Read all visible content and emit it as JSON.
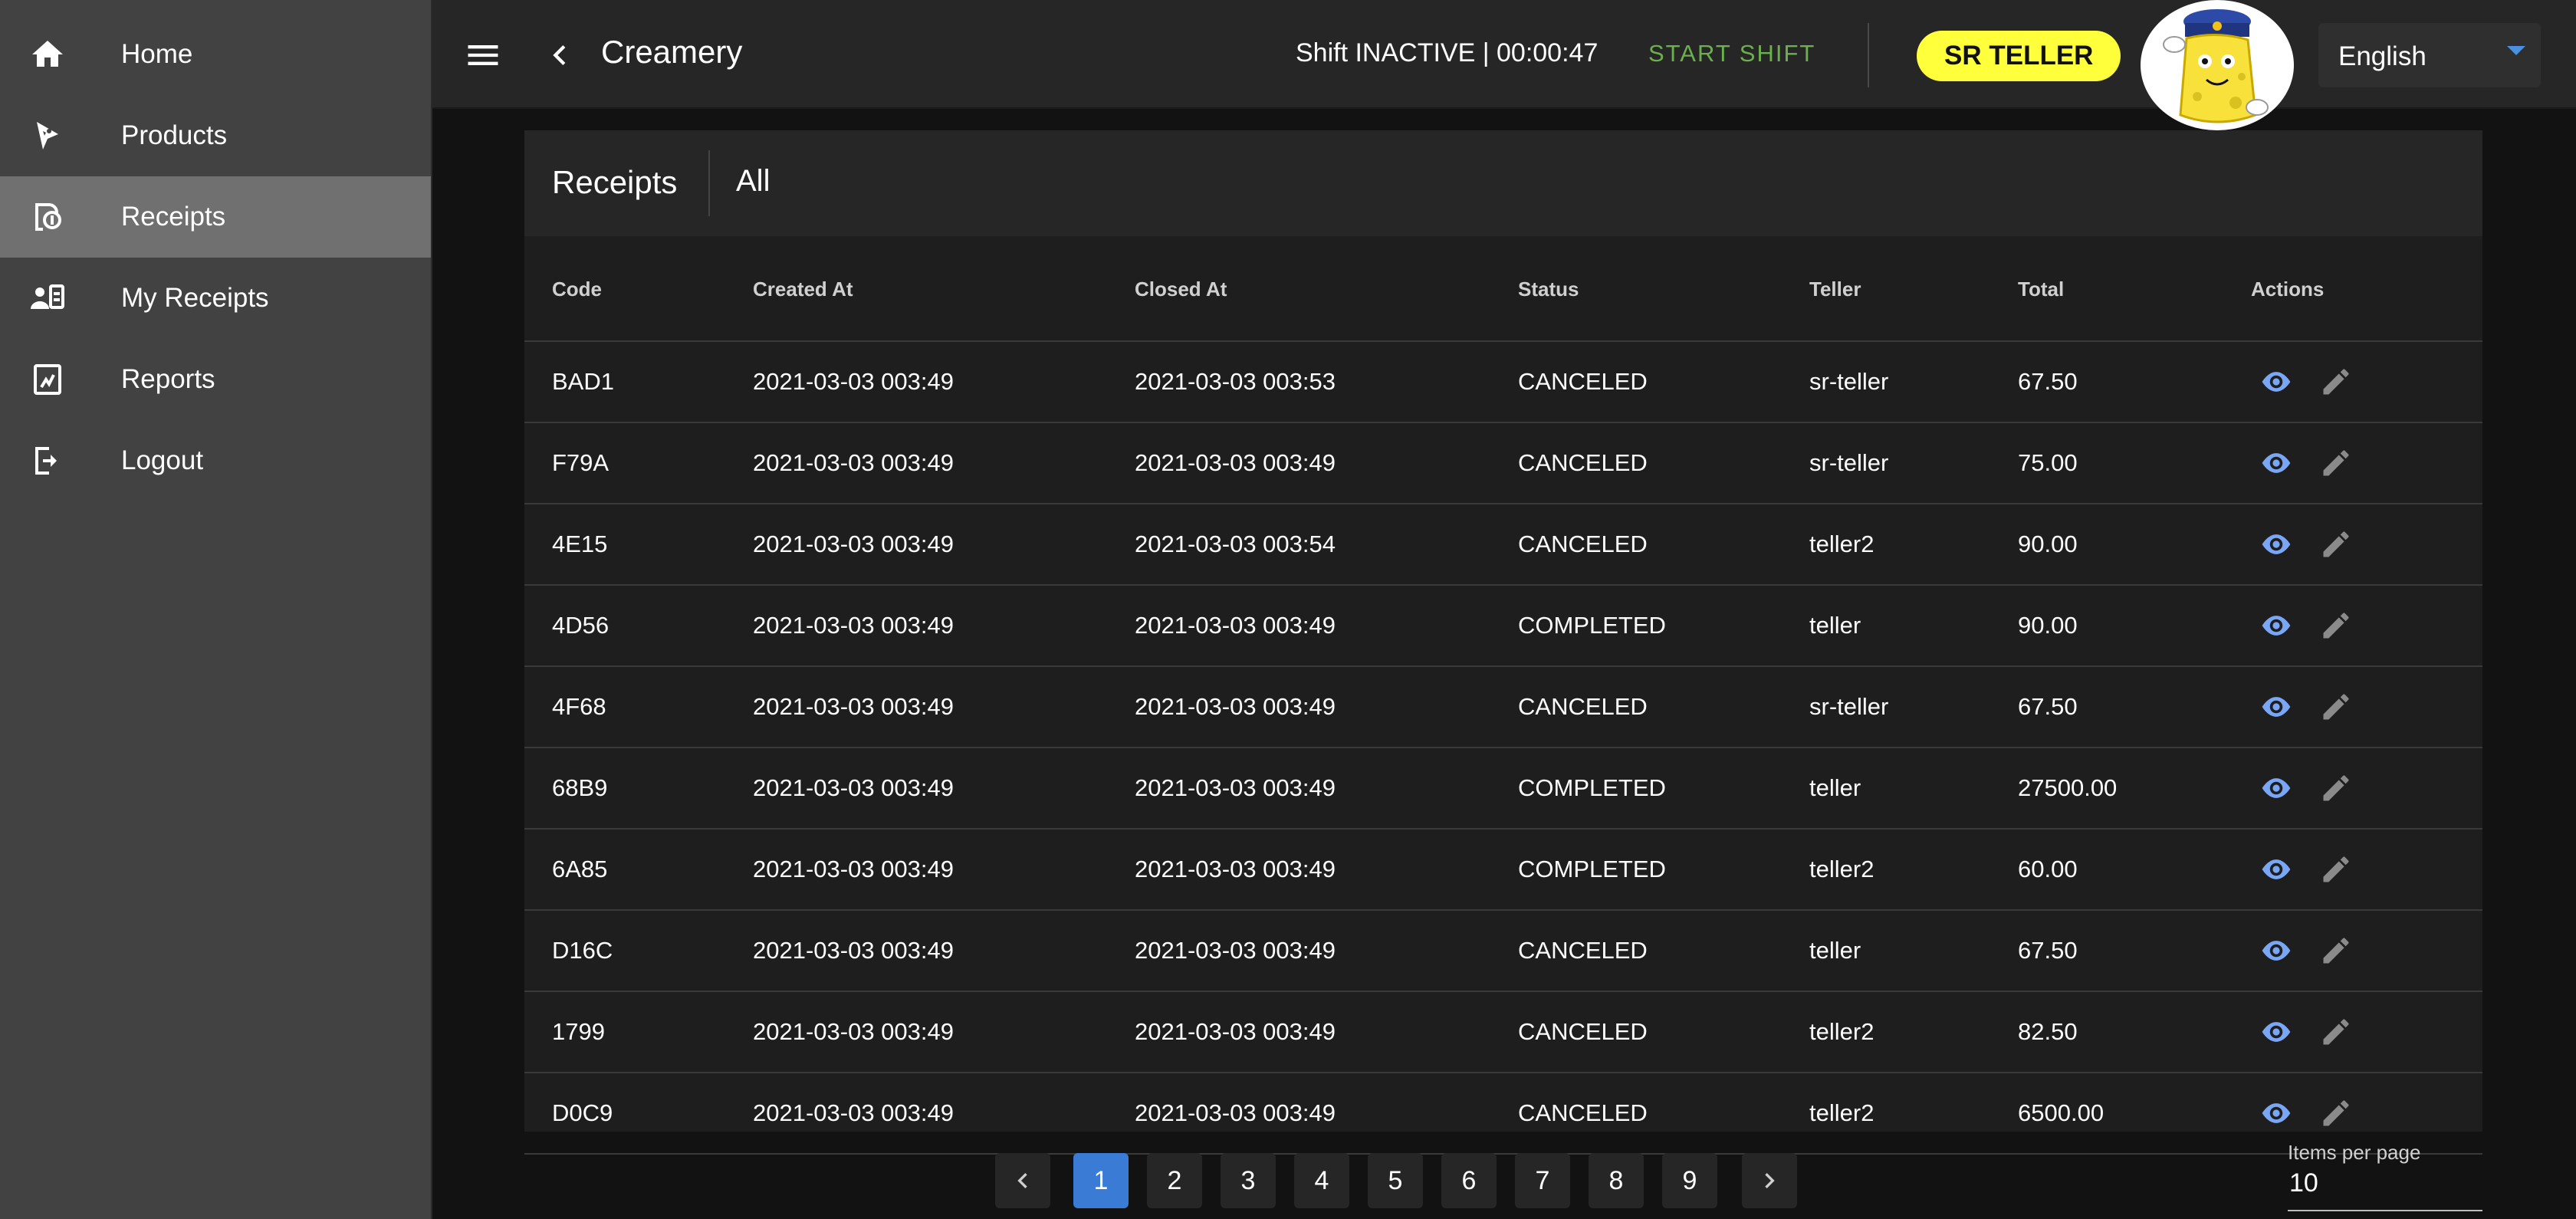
{
  "sidebar": {
    "items": [
      {
        "label": "Home",
        "icon": "home-icon"
      },
      {
        "label": "Products",
        "icon": "products-icon"
      },
      {
        "label": "Receipts",
        "icon": "receipts-icon",
        "active": true
      },
      {
        "label": "My Receipts",
        "icon": "my-receipts-icon"
      },
      {
        "label": "Reports",
        "icon": "reports-icon"
      },
      {
        "label": "Logout",
        "icon": "logout-icon"
      }
    ]
  },
  "header": {
    "title": "Creamery",
    "shift_status": "Shift INACTIVE | 00:00:47",
    "start_shift_label": "START SHIFT",
    "role_badge": "SR TELLER",
    "language": "English"
  },
  "colors": {
    "accent": "#3a7bd5",
    "badge": "#ffff3c",
    "start_shift": "#6ab04c",
    "action_icon_view": "#7aa7f5"
  },
  "card": {
    "title": "Receipts",
    "filter": "All"
  },
  "table": {
    "columns": [
      "Code",
      "Created At",
      "Closed At",
      "Status",
      "Teller",
      "Total",
      "Actions"
    ],
    "rows": [
      {
        "code": "BAD1",
        "created": "2021-03-03 003:49",
        "closed": "2021-03-03 003:53",
        "status": "CANCELED",
        "teller": "sr-teller",
        "total": "67.50"
      },
      {
        "code": "F79A",
        "created": "2021-03-03 003:49",
        "closed": "2021-03-03 003:49",
        "status": "CANCELED",
        "teller": "sr-teller",
        "total": "75.00"
      },
      {
        "code": "4E15",
        "created": "2021-03-03 003:49",
        "closed": "2021-03-03 003:54",
        "status": "CANCELED",
        "teller": "teller2",
        "total": "90.00"
      },
      {
        "code": "4D56",
        "created": "2021-03-03 003:49",
        "closed": "2021-03-03 003:49",
        "status": "COMPLETED",
        "teller": "teller",
        "total": "90.00"
      },
      {
        "code": "4F68",
        "created": "2021-03-03 003:49",
        "closed": "2021-03-03 003:49",
        "status": "CANCELED",
        "teller": "sr-teller",
        "total": "67.50"
      },
      {
        "code": "68B9",
        "created": "2021-03-03 003:49",
        "closed": "2021-03-03 003:49",
        "status": "COMPLETED",
        "teller": "teller",
        "total": "27500.00"
      },
      {
        "code": "6A85",
        "created": "2021-03-03 003:49",
        "closed": "2021-03-03 003:49",
        "status": "COMPLETED",
        "teller": "teller2",
        "total": "60.00"
      },
      {
        "code": "D16C",
        "created": "2021-03-03 003:49",
        "closed": "2021-03-03 003:49",
        "status": "CANCELED",
        "teller": "teller",
        "total": "67.50"
      },
      {
        "code": "1799",
        "created": "2021-03-03 003:49",
        "closed": "2021-03-03 003:49",
        "status": "CANCELED",
        "teller": "teller2",
        "total": "82.50"
      },
      {
        "code": "D0C9",
        "created": "2021-03-03 003:49",
        "closed": "2021-03-03 003:49",
        "status": "CANCELED",
        "teller": "teller2",
        "total": "6500.00"
      }
    ]
  },
  "pagination": {
    "pages": [
      "1",
      "2",
      "3",
      "4",
      "5",
      "6",
      "7",
      "8",
      "9"
    ],
    "current": "1",
    "items_per_page_label": "Items per page",
    "items_per_page": "10"
  }
}
